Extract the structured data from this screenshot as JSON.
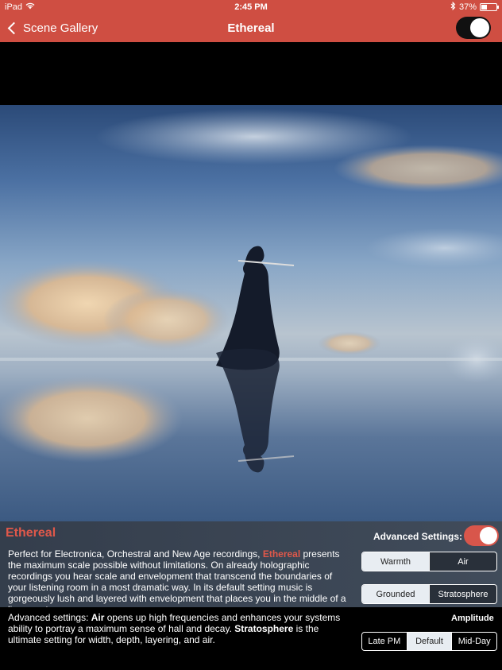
{
  "status": {
    "device": "iPad",
    "time": "2:45 PM",
    "battery": "37%",
    "battery_level": 0.37
  },
  "nav": {
    "back_label": "Scene Gallery",
    "title": "Ethereal",
    "toggle_on": true
  },
  "info": {
    "title": "Ethereal",
    "desc_1": "Perfect for Electronica, Orchestral and New Age recordings, ",
    "desc_highlight": "Ethereal",
    "desc_2": " presents the maximum scale possible without limitations. On already holographic recordings you hear scale and envelopment that transcend the boundaries of your listening room in a most dramatic way. In its default setting music is gorgeously lush and layered with envelopment that places you in the middle of a live event."
  },
  "advanced": {
    "label": "Advanced Settings:",
    "enabled": true,
    "row1": [
      {
        "label": "Warmth",
        "selected": true
      },
      {
        "label": "Air",
        "selected": false
      }
    ],
    "row2": [
      {
        "label": "Grounded",
        "selected": true
      },
      {
        "label": "Stratosphere",
        "selected": false
      }
    ]
  },
  "lower": {
    "p1": "Advanced settings: ",
    "b1": "Air",
    "p2": " opens up high frequencies and enhances your systems ability to portray a maximum sense of hall and decay. ",
    "b2": "Stratosphere",
    "p3": " is the ultimate setting for width, depth, layering, and air."
  },
  "amplitude": {
    "label": "Amplitude",
    "options": [
      {
        "label": "Late PM",
        "selected": false
      },
      {
        "label": "Default",
        "selected": true
      },
      {
        "label": "Mid-Day",
        "selected": false
      }
    ]
  },
  "colors": {
    "accent": "#cf4e42",
    "highlight": "#e0584a"
  },
  "icons": {
    "wifi": "wifi-icon",
    "bluetooth": "bluetooth-icon",
    "battery": "battery-icon",
    "back": "chevron-left-icon"
  }
}
